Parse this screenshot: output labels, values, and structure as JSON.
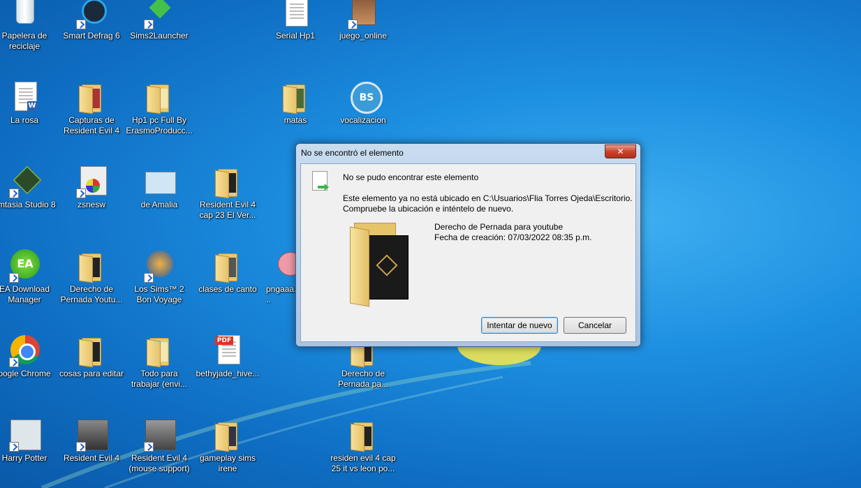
{
  "desktop_icons": {
    "recycle_bin": "Papelera de reciclaje",
    "smart_defrag": "Smart Defrag 6",
    "sims2launcher": "Sims2Launcher",
    "serial_hp1": "Serial Hp1",
    "juego_online": "juego_online",
    "la_rosa": "La rosa",
    "capturas_re4": "Capturas de Resident Evil 4",
    "hp1_pc": "Hp1 pc Full By ErasmoProducc...",
    "matas": "matas",
    "vocalizacion": "vocalizacion",
    "camtasia": "amtasia Studio 8",
    "zsnesw": "zsnesw",
    "de_amalia": "de Amalia",
    "re4_cap23": "Resident Evil 4 cap 23 El Ver...",
    "ea_download": "EA Download Manager",
    "derecho_pernada_1": "Derecho de Pernada Youtu...",
    "sims2_bon_voyage": "Los Sims™ 2 Bon Voyage",
    "clases_canto": "clases de canto",
    "pngaaa": "pngaaa...",
    "chrome": "oogle Chrome",
    "cosas_editar": "cosas para editar",
    "todo_trabajar": "Todo para trabajar (envi...",
    "bethyjade": "bethyjade_hive...",
    "derecho_pernada_2": "Derecho de Pernada pa...",
    "harry_potter": "Harry Potter",
    "re4": "Resident Evil 4",
    "re4_mouse": "Resident Evil 4 (mouse support)",
    "gameplay_sims": "gameplay sims irene",
    "residen_ev4_cap25": "residen evil 4 cap 25 it vs leon po..."
  },
  "dialog": {
    "title": "No se encontró el elemento",
    "close_glyph": "✕",
    "heading": "No se pudo encontrar este elemento",
    "message_line1": "Este elemento ya no está ubicado en C:\\Usuarios\\Flia Torres Ojeda\\Escritorio.",
    "message_line2": "Compruebe la ubicación e inténtelo de nuevo.",
    "item_name": "Derecho de Pernada para youtube",
    "item_date": "Fecha de creación: 07/03/2022 08:35 p.m.",
    "retry_label": "Intentar de nuevo",
    "cancel_label": "Cancelar"
  },
  "colors": {
    "desktop": "#1d8fe0",
    "dialog_frame": "#a9c3e2",
    "close_button": "#c9452c"
  }
}
